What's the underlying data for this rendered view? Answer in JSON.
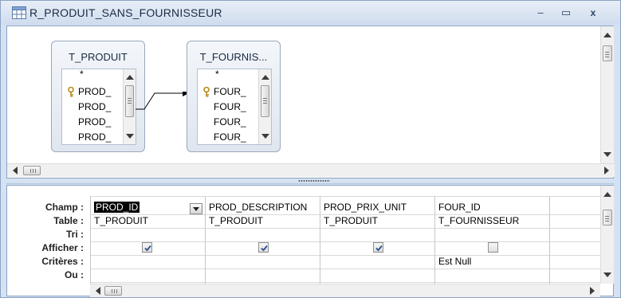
{
  "window": {
    "title": "R_PRODUIT_SANS_FOURNISSEUR",
    "controls": {
      "minimize": "–",
      "maximize": "▭",
      "close": "x"
    },
    "icon": "query-table-icon"
  },
  "design": {
    "tables": [
      {
        "title": "T_PRODUIT",
        "fields": [
          {
            "label": "*",
            "key": false
          },
          {
            "label": "PROD_",
            "key": true
          },
          {
            "label": "PROD_",
            "key": false
          },
          {
            "label": "PROD_",
            "key": false
          },
          {
            "label": "PROD_",
            "key": false
          }
        ]
      },
      {
        "title": "T_FOURNIS...",
        "fields": [
          {
            "label": "*",
            "key": false
          },
          {
            "label": "FOUR_",
            "key": true
          },
          {
            "label": "FOUR_",
            "key": false
          },
          {
            "label": "FOUR_",
            "key": false
          },
          {
            "label": "FOUR_",
            "key": false
          }
        ]
      }
    ],
    "relationship": {
      "type": "left-outer-join-arrow"
    }
  },
  "grid": {
    "row_labels": [
      "Champ :",
      "Table :",
      "Tri :",
      "Afficher :",
      "Critères :",
      "Ou :"
    ],
    "columns": [
      {
        "champ": "PROD_ID",
        "table": "T_PRODUIT",
        "tri": "",
        "afficher": true,
        "criteres": "",
        "ou": "",
        "selected": true
      },
      {
        "champ": "PROD_DESCRIPTION",
        "table": "T_PRODUIT",
        "tri": "",
        "afficher": true,
        "criteres": "",
        "ou": ""
      },
      {
        "champ": "PROD_PRIX_UNIT",
        "table": "T_PRODUIT",
        "tri": "",
        "afficher": true,
        "criteres": "",
        "ou": ""
      },
      {
        "champ": "FOUR_ID",
        "table": "T_FOURNISSEUR",
        "tri": "",
        "afficher": false,
        "criteres": "Est Null",
        "ou": ""
      },
      {
        "champ": "",
        "table": "",
        "tri": "",
        "afficher": null,
        "criteres": "",
        "ou": ""
      }
    ]
  }
}
